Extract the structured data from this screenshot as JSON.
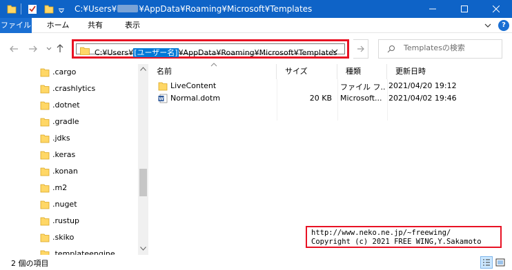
{
  "window": {
    "title_prefix": "C:¥Users¥",
    "title_suffix": "¥AppData¥Roaming¥Microsoft¥Templates"
  },
  "ribbon": {
    "tabs": [
      "ファイル",
      "ホーム",
      "共有",
      "表示"
    ],
    "help_label": "?"
  },
  "address": {
    "prefix": "C:¥Users¥",
    "selected": "[ユーザー名]",
    "suffix": "¥AppData¥Roaming¥Microsoft¥Templates"
  },
  "search": {
    "placeholder": "Templatesの検索"
  },
  "nav": {
    "items": [
      ".cargo",
      ".crashlytics",
      ".dotnet",
      ".gradle",
      ".jdks",
      ".keras",
      ".konan",
      ".m2",
      ".nuget",
      ".rustup",
      ".skiko",
      ".templateengine"
    ]
  },
  "list": {
    "headers": {
      "name": "名前",
      "size": "サイズ",
      "type": "種類",
      "date": "更新日時"
    },
    "rows": [
      {
        "name": "LiveContent",
        "size": "",
        "type": "ファイル フ...",
        "date": "2021/04/20 19:12",
        "icon": "folder-icon"
      },
      {
        "name": "Normal.dotm",
        "size": "20 KB",
        "type": "Microsoft...",
        "date": "2021/04/02 19:46",
        "icon": "word-doc-icon"
      }
    ]
  },
  "watermark": {
    "line1": "http://www.neko.ne.jp/~freewing/",
    "line2": "Copyright (c) 2021 FREE WING,Y.Sakamoto"
  },
  "status": {
    "count": "2 個の項目"
  },
  "colors": {
    "titlebar": "#0e63c7",
    "accent": "#0078d7",
    "highlight": "#e81123",
    "folder": "#ffd766"
  }
}
